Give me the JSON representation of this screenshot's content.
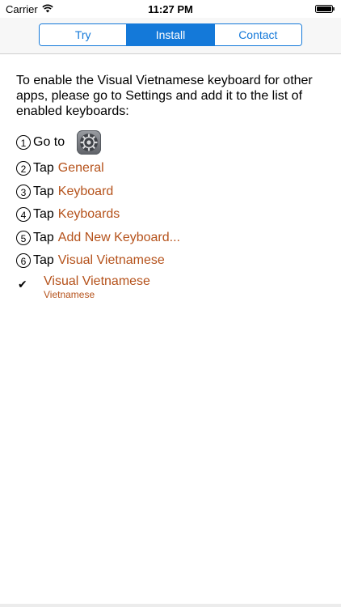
{
  "status_bar": {
    "carrier": "Carrier",
    "time": "11:27 PM"
  },
  "tabs": [
    {
      "label": "Try",
      "selected": false
    },
    {
      "label": "Install",
      "selected": true
    },
    {
      "label": "Contact",
      "selected": false
    }
  ],
  "content": {
    "intro": "To enable the Visual Vietnamese keyboard for other apps, please go to Settings and add it to the list of enabled keyboards:",
    "steps": [
      {
        "num": "1",
        "verb": "Go to",
        "target": "",
        "icon": "settings-gear-icon"
      },
      {
        "num": "2",
        "verb": "Tap",
        "target": "General"
      },
      {
        "num": "3",
        "verb": "Tap",
        "target": "Keyboard"
      },
      {
        "num": "4",
        "verb": "Tap",
        "target": "Keyboards"
      },
      {
        "num": "5",
        "verb": "Tap",
        "target": "Add New Keyboard..."
      },
      {
        "num": "6",
        "verb": "Tap",
        "target": "Visual Vietnamese"
      }
    ],
    "keyboard_entry": {
      "check": "✔",
      "name": "Visual Vietnamese",
      "language": "Vietnamese"
    }
  },
  "colors": {
    "accent": "#1479d9",
    "link": "#b5521b"
  }
}
